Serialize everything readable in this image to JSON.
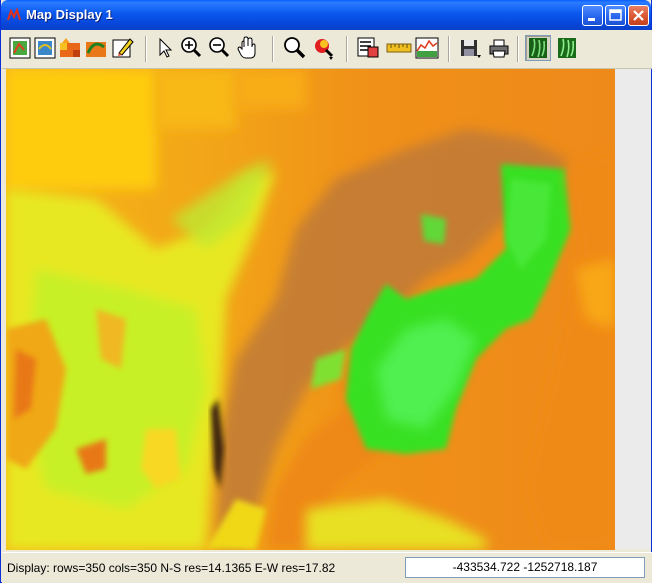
{
  "window": {
    "title": "Map Display 1",
    "app_icon": "grass-logo-icon",
    "controls": [
      "minimize-icon",
      "maximize-icon",
      "close-icon"
    ]
  },
  "toolbar": {
    "buttons": [
      {
        "name": "display-map-button",
        "icon": "display-map-icon"
      },
      {
        "name": "redraw-map-button",
        "icon": "redraw-map-icon"
      },
      {
        "name": "add-raster-button",
        "icon": "add-raster-icon"
      },
      {
        "name": "add-vector-button",
        "icon": "add-vector-icon"
      },
      {
        "name": "erase-display-button",
        "icon": "erase-icon"
      },
      {
        "name": "pointer-button",
        "icon": "pointer-arrow-icon"
      },
      {
        "name": "zoom-in-button",
        "icon": "zoom-in-icon"
      },
      {
        "name": "zoom-out-button",
        "icon": "zoom-out-icon"
      },
      {
        "name": "pan-button",
        "icon": "pan-hand-icon"
      },
      {
        "name": "query-button",
        "icon": "query-magnifier-icon"
      },
      {
        "name": "zoom-menu-button",
        "icon": "zoom-menu-icon"
      },
      {
        "name": "overlay-button",
        "icon": "overlay-icon"
      },
      {
        "name": "measure-button",
        "icon": "ruler-icon"
      },
      {
        "name": "profile-button",
        "icon": "profile-icon"
      },
      {
        "name": "save-button",
        "icon": "floppy-disk-icon"
      },
      {
        "name": "print-button",
        "icon": "printer-icon"
      },
      {
        "name": "map-display-mode-button",
        "icon": "map-mode-icon",
        "active": true
      },
      {
        "name": "digitize-mode-button",
        "icon": "digitize-mode-icon",
        "active": false
      }
    ]
  },
  "map": {
    "colors": {
      "orange": "#f08a1c",
      "yellow": "#ffd000",
      "green": "#28e81e",
      "lime": "#d4f020",
      "brown": "#b07840",
      "dark": "#3a2010"
    }
  },
  "status": {
    "display_text": "Display: rows=350 cols=350  N-S res=14.1365  E-W res=17.82",
    "coordinates": "-433534.722 -1252718.187"
  }
}
